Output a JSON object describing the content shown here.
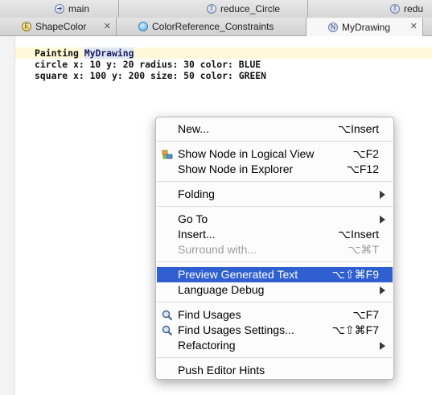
{
  "tabs_row1": [
    {
      "label": "main",
      "icon": "arrow-circle-icon"
    },
    {
      "label": "reduce_Circle",
      "icon": "t-circle-icon"
    },
    {
      "label": "redu",
      "icon": "t-circle-icon"
    }
  ],
  "tabs_row2": [
    {
      "label": "ShapeColor",
      "icon": "e-circle-icon"
    },
    {
      "label": "ColorReference_Constraints",
      "icon": "globe-icon"
    },
    {
      "label": "MyDrawing",
      "icon": "n-circle-icon",
      "active": true
    }
  ],
  "code": {
    "line1_keyword": "Painting",
    "line1_name": "MyDrawing",
    "line2": "circle x: 10 y: 20 radius: 30 color: BLUE",
    "line3": "square x: 100 y: 200 size: 50 color: GREEN"
  },
  "menu": {
    "new": {
      "label": "New...",
      "shortcut": "⌥Insert"
    },
    "show_logical": {
      "label": "Show Node in Logical View",
      "shortcut": "⌥F2"
    },
    "show_explorer": {
      "label": "Show Node in Explorer",
      "shortcut": "⌥F12"
    },
    "folding": {
      "label": "Folding"
    },
    "goto": {
      "label": "Go To"
    },
    "insert": {
      "label": "Insert...",
      "shortcut": "⌥Insert"
    },
    "surround": {
      "label": "Surround with...",
      "shortcut": "⌥⌘T"
    },
    "preview": {
      "label": "Preview Generated Text",
      "shortcut": "⌥⇧⌘F9"
    },
    "lang_debug": {
      "label": "Language Debug"
    },
    "find_usages": {
      "label": "Find Usages",
      "shortcut": "⌥F7"
    },
    "find_usages_settings": {
      "label": "Find Usages Settings...",
      "shortcut": "⌥⇧⌘F7"
    },
    "refactoring": {
      "label": "Refactoring"
    },
    "push_hints": {
      "label": "Push Editor Hints"
    }
  },
  "colors": {
    "highlight": "#2f5fd0",
    "disabled_text": "#9c9c9c"
  }
}
